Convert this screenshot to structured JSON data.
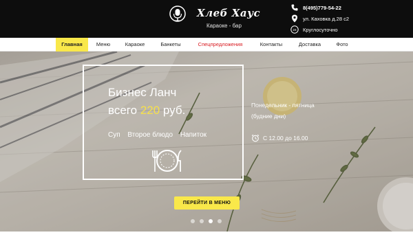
{
  "header": {
    "brand": "Хлеб Хаус",
    "tagline": "Караоке - бар",
    "logo_icon": "microphone-icon",
    "phone": "8(495)779-54-22",
    "address": "ул. Каховка д.28 с2",
    "hours": "Круглосуточно",
    "hours_icon_text": "24"
  },
  "nav": {
    "items": [
      {
        "label": "Главная",
        "active": true
      },
      {
        "label": "Меню"
      },
      {
        "label": "Караоке"
      },
      {
        "label": "Банкеты"
      },
      {
        "label": "Спецпредложения",
        "color": "#d8191f"
      },
      {
        "label": "Контакты"
      },
      {
        "label": "Доставка"
      },
      {
        "label": "Фото"
      }
    ]
  },
  "hero": {
    "title": "Бизнес Ланч",
    "price_prefix": "всего",
    "price": "220",
    "price_suffix": "руб.",
    "items": [
      "Суп",
      "Второе блюдо",
      "Напиток"
    ],
    "days": "Понедельник - пятница",
    "days_note": "(будние дни)",
    "time": "С 12.00 до 16.00",
    "button": "ПЕРЕЙТИ В МЕНЮ",
    "slides": 4,
    "active_slide": 3
  },
  "colors": {
    "header_bg": "#0d0d0d",
    "accent_yellow": "#f9e84a",
    "special_red": "#d8191f",
    "price_yellow": "#f6e04a"
  }
}
